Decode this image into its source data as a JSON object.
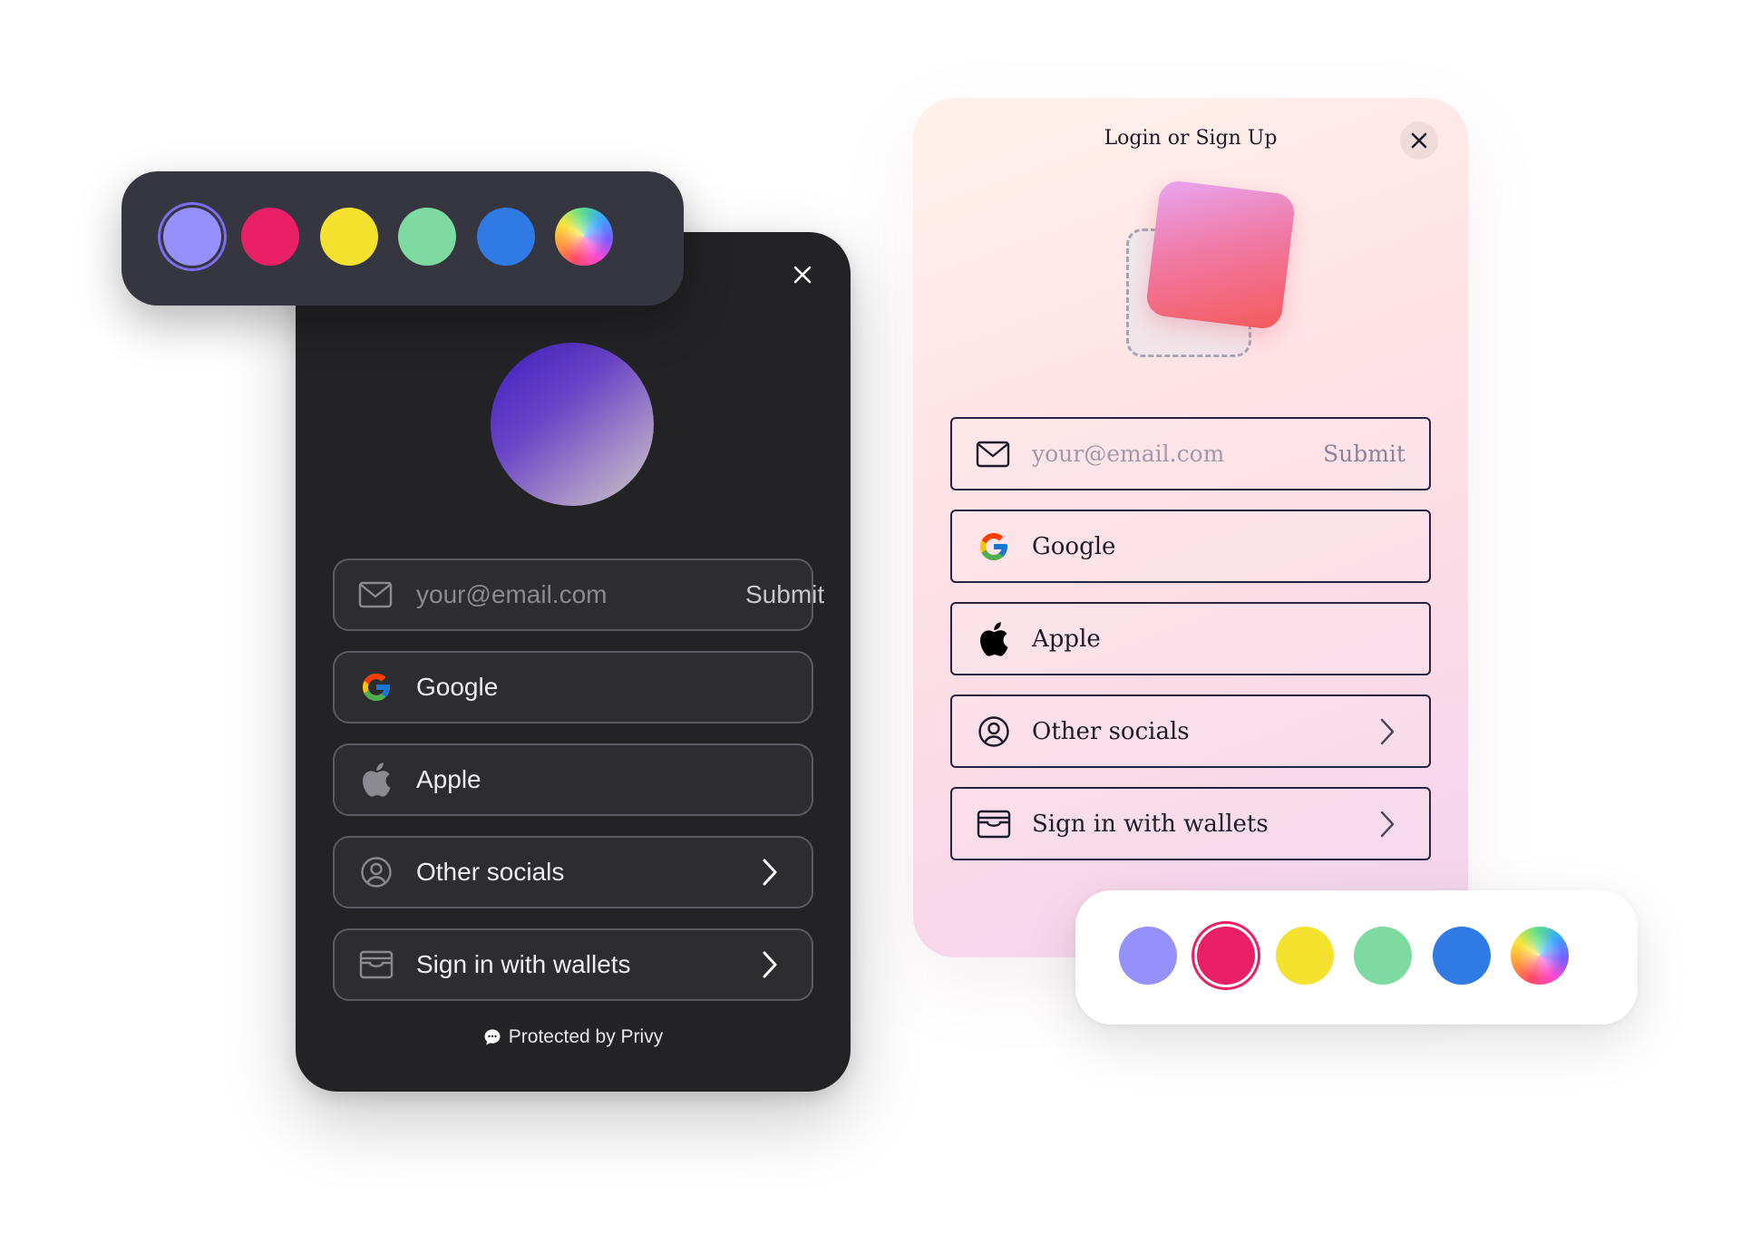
{
  "dark_modal": {
    "email_placeholder": "your@email.com",
    "submit_label": "Submit",
    "buttons": [
      {
        "label": "Google",
        "icon": "google-icon"
      },
      {
        "label": "Apple",
        "icon": "apple-icon"
      },
      {
        "label": "Other socials",
        "icon": "user-circle-icon"
      },
      {
        "label": "Sign in with wallets",
        "icon": "wallet-icon"
      }
    ],
    "footer": "Protected by Privy"
  },
  "light_modal": {
    "title": "Login or Sign Up",
    "email_placeholder": "your@email.com",
    "submit_label": "Submit",
    "buttons": [
      {
        "label": "Google",
        "icon": "google-icon"
      },
      {
        "label": "Apple",
        "icon": "apple-icon"
      },
      {
        "label": "Other socials",
        "icon": "user-circle-icon"
      },
      {
        "label": "Sign in with wallets",
        "icon": "wallet-icon"
      }
    ]
  },
  "palettes": {
    "swatches": [
      {
        "name": "purple",
        "color": "#9690fa"
      },
      {
        "name": "pink",
        "color": "#ea2066"
      },
      {
        "name": "yellow",
        "color": "#f5e22f"
      },
      {
        "name": "green",
        "color": "#7ddba2"
      },
      {
        "name": "blue",
        "color": "#2f7ae5"
      },
      {
        "name": "rainbow",
        "color": "conic-gradient"
      }
    ],
    "dark_selected": "purple",
    "light_selected": "pink"
  }
}
